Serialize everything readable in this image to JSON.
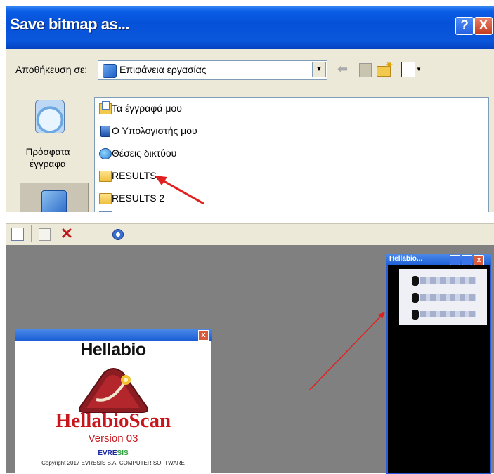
{
  "dialog": {
    "title": "Save bitmap as...",
    "help_label": "?",
    "close_label": "X",
    "save_in_label": "Αποθήκευση σε:",
    "save_in_value": "Επιφάνεια εργασίας",
    "places": [
      {
        "label": "Πρόσφατα έγγραφα",
        "icon": "recent-documents-icon"
      },
      {
        "label": "",
        "icon": "desktop-icon"
      }
    ],
    "files": [
      {
        "label": "Τα έγγραφά μου",
        "icon": "my-documents-icon"
      },
      {
        "label": "Ο Υπολογιστής μου",
        "icon": "my-computer-icon"
      },
      {
        "label": "Θέσεις δικτύου",
        "icon": "network-places-icon"
      },
      {
        "label": "RESULTS",
        "icon": "folder-icon"
      },
      {
        "label": "RESULTS 2",
        "icon": "folder-icon"
      }
    ]
  },
  "splash": {
    "brand": "Hellabio",
    "product": "HellabioScan",
    "version": "Version 03",
    "vendor_logo": "EVRESIS",
    "copyright": "Copyright 2017  EVRESIS S.A. COMPUTER SOFTWARE",
    "close_label": "x"
  },
  "image_window": {
    "title": "Hellabio...",
    "close_label": "x"
  },
  "colors": {
    "title_blue": "#0551d8",
    "dialog_bg": "#ece9d8",
    "workspace_gray": "#808080",
    "brand_red": "#c8151b",
    "annotation_arrow": "#e02020"
  }
}
